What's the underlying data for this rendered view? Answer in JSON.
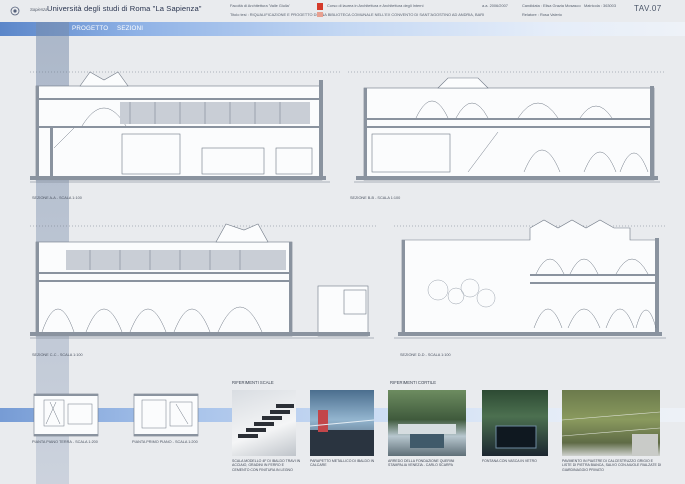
{
  "header": {
    "logo_text": "Sapienza",
    "university": "Università degli studi di Roma \"La Sapienza\"",
    "faculty": "Facoltà di Architettura 'Valle Giulia'",
    "course": "Corso di laurea in Architettura e Architettura degli Interni",
    "year": "a.a. 2006/2007",
    "candidate": "Candidata : Elisa Grazia Mosasco",
    "matricola": "Matricola : 363003",
    "thesis_title": "Titolo tesi : RIQUALIFICAZIONE E PROGETTO DI UNA BIBLIOTECA COMUNALE NELL'EX CONVENTO DI SANT'AGOSTINO AD ANDRIA, BARI",
    "relatore": "Relatore : Rosa Valerio",
    "tav": "TAV.07"
  },
  "nav": {
    "progetto": "PROGETTO",
    "sezioni": "SEZIONI"
  },
  "drawings": {
    "section_a": "SEZIONE A-A - SCALA 1:100",
    "section_b": "SEZIONE B-B - SCALA 1:100",
    "section_c": "SEZIONE C-C - SCALA 1:100",
    "section_d": "SEZIONE D-D - SCALA 1:100"
  },
  "plans": {
    "plan_ground": "PIANTA PIANO TERRA - SCALA 1:200",
    "plan_first": "PIANTA PRIMO PIANO - SCALA 1:200"
  },
  "gallery": {
    "label_scale": "RIFERIMENTI SCALE",
    "label_cortile": "RIFERIMENTI CORTILE",
    "cap_1": "SCALA MODELLO 4F DI IBALDO TRAVI IN ACCIAIO, GRADINI IN FERRO E CEMENTO CON FINITURA IN LEGNO",
    "cap_2": "PARAPETTO METALLICO DI IBALDO IN CALCARE",
    "cap_3": "ARREDO DELLA FONDAZIONE QUERINI STAMPALIA VENEZIA - CARLO SCARPA",
    "cap_4": "FONTANA CON VASCA IN VETRO",
    "cap_5": "PAVIMENTO IN PIASTRE DI CALCESTRUZZO GRIGIO E LISTE DI PIETRA BIANCA, SALVO CON AIUOLE RIALZATE DI GIARDINAGGIO PRIVATO"
  },
  "colors": {
    "accent_blue": "#6a93d2",
    "background": "#e9ebee",
    "pdf_red": "#d43a2a"
  }
}
